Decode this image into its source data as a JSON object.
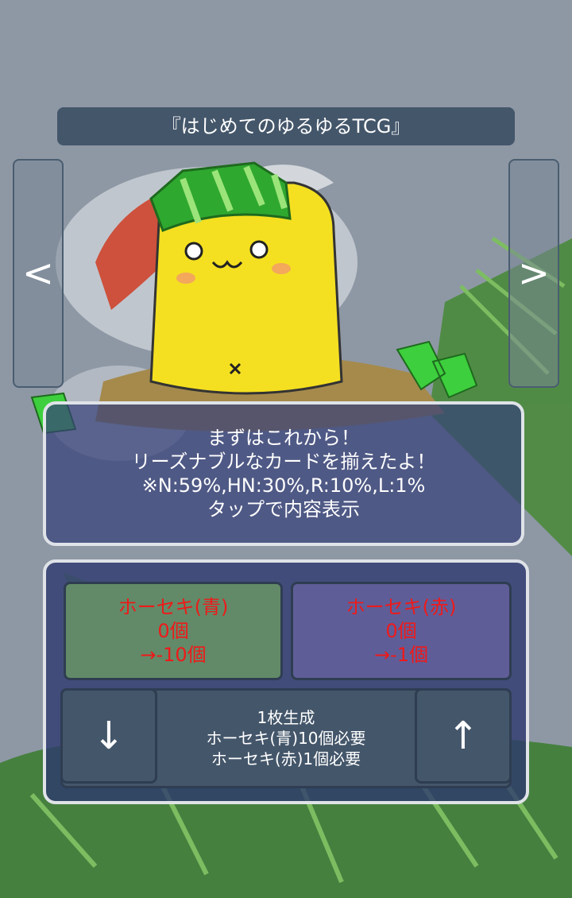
{
  "title": "『はじめてのゆるゆるTCG』",
  "nav": {
    "prev_label": "<",
    "next_label": ">"
  },
  "info": {
    "line1": "まずはこれから！",
    "line2": "リーズナブルなカードを揃えたよ！",
    "line3": "※N:59%,HN:30%,R:10%,L:1%",
    "line4": "タップで内容表示"
  },
  "gems": {
    "blue": {
      "name": "ホーセキ(青)",
      "count": "0個",
      "cost": "→-10個"
    },
    "red": {
      "name": "ホーセキ(赤)",
      "count": "0個",
      "cost": "→-1個"
    }
  },
  "generate": {
    "down_label": "↓",
    "up_label": "↑",
    "line1": "1枚生成",
    "line2": "ホーセキ(青)10個必要",
    "line3": "ホーセキ(赤)1個必要"
  },
  "colors": {
    "title_bar": "#44566a",
    "gem_blue_bg": "#628a68",
    "gem_red_bg": "#5f5d98",
    "gem_text": "#ee1a1a"
  }
}
